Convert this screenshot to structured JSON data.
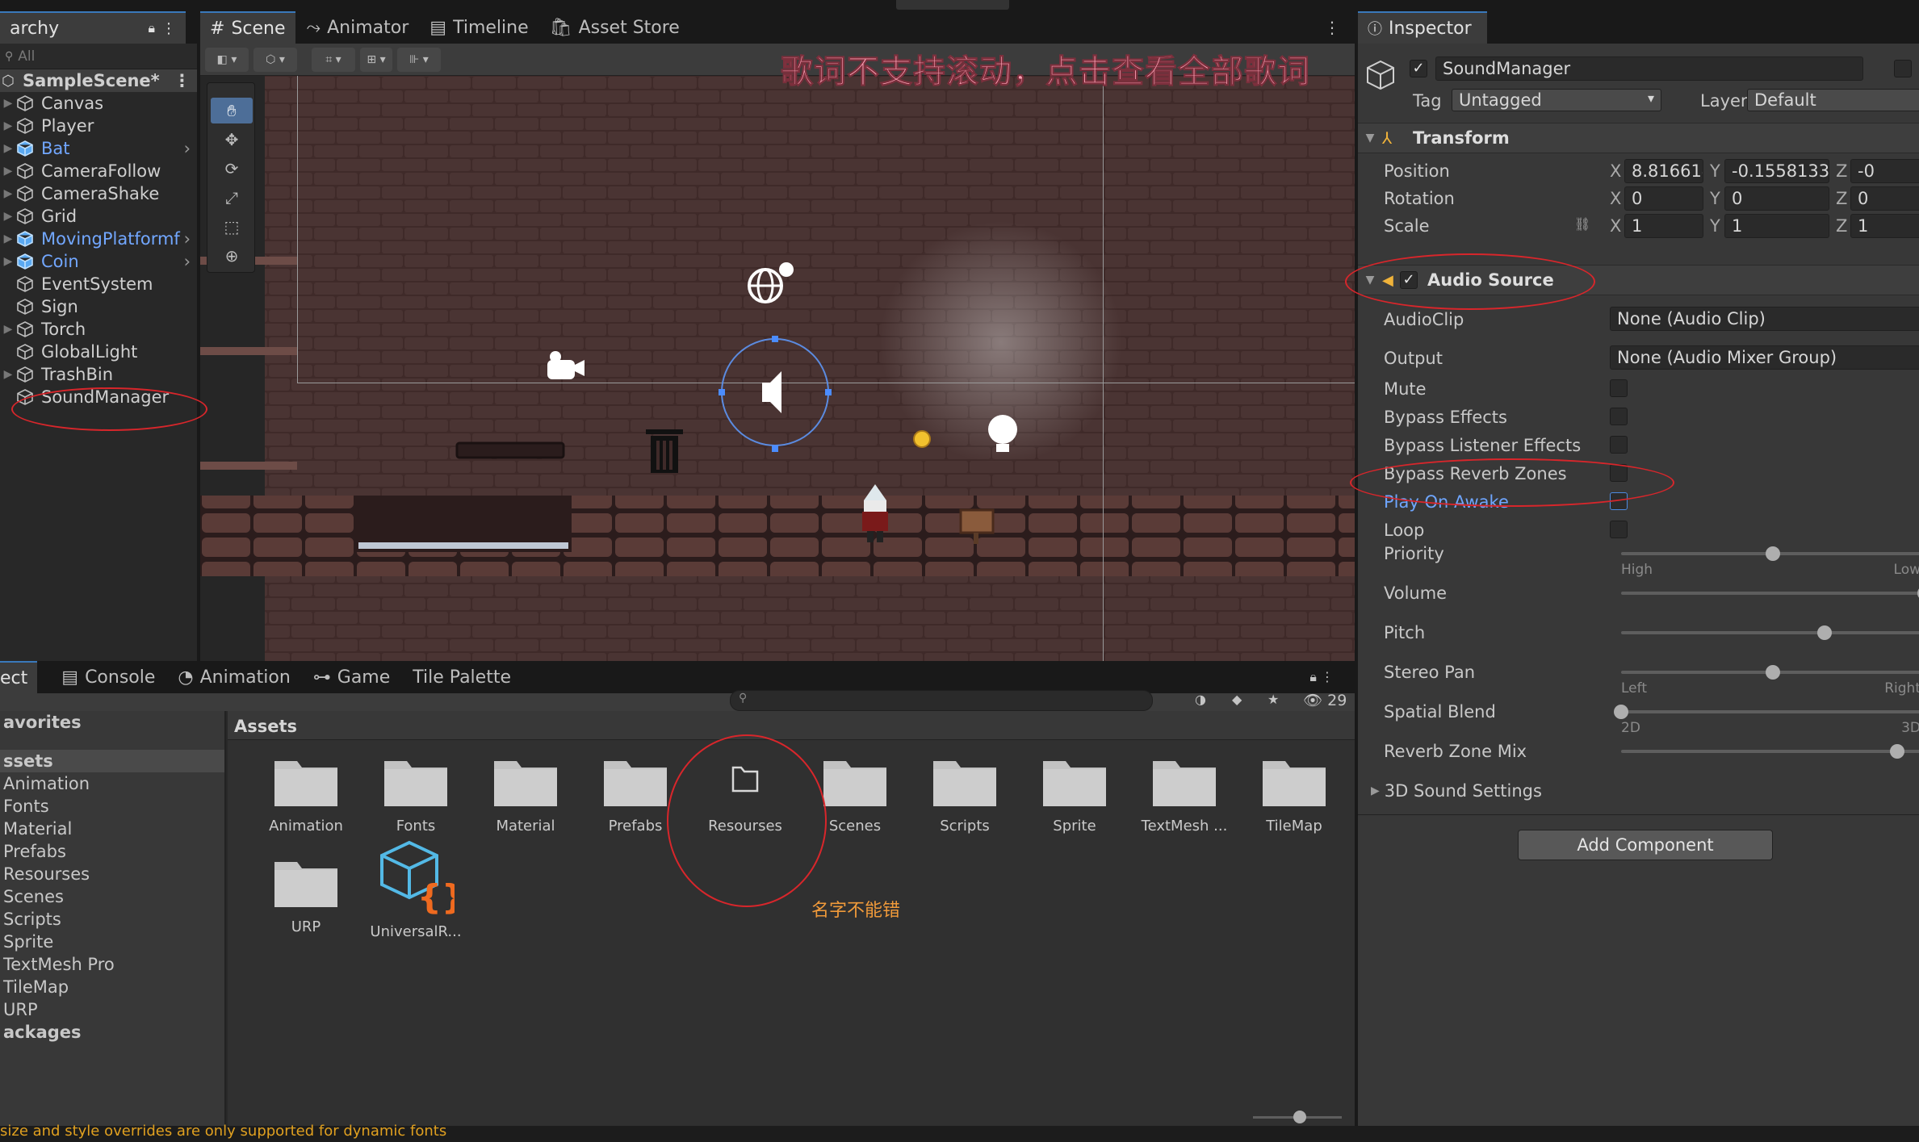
{
  "hierarchy": {
    "tab_label": "archy",
    "search_placeholder": "All",
    "scene_name": "SampleScene*",
    "items": [
      {
        "label": "Canvas",
        "prefab": false,
        "fold": true
      },
      {
        "label": "Player",
        "prefab": false,
        "fold": true
      },
      {
        "label": "Bat",
        "prefab": true,
        "fold": true
      },
      {
        "label": "CameraFollow",
        "prefab": false,
        "fold": true
      },
      {
        "label": "CameraShake",
        "prefab": false,
        "fold": true
      },
      {
        "label": "Grid",
        "prefab": false,
        "fold": true
      },
      {
        "label": "MovingPlatformf",
        "prefab": true,
        "fold": true
      },
      {
        "label": "Coin",
        "prefab": true,
        "fold": true
      },
      {
        "label": "EventSystem",
        "prefab": false,
        "fold": false
      },
      {
        "label": "Sign",
        "prefab": false,
        "fold": false
      },
      {
        "label": "Torch",
        "prefab": false,
        "fold": true
      },
      {
        "label": "GlobalLight",
        "prefab": false,
        "fold": false
      },
      {
        "label": "TrashBin",
        "prefab": false,
        "fold": true
      },
      {
        "label": "SoundManager",
        "prefab": false,
        "fold": false
      }
    ]
  },
  "scene_tabs": [
    "Scene",
    "Animator",
    "Timeline",
    "Asset Store"
  ],
  "lyric_banner": "歌词不支持滚动，点击查看全部歌词",
  "inspector": {
    "tab_label": "Inspector",
    "object_name": "SoundManager",
    "tag_label": "Tag",
    "tag_value": "Untagged",
    "layer_label": "Layer",
    "layer_value": "Default",
    "transform": {
      "title": "Transform",
      "rows": [
        {
          "label": "Position",
          "x": "8.816614",
          "y": "-0.1558133",
          "z": "-0"
        },
        {
          "label": "Rotation",
          "x": "0",
          "y": "0",
          "z": "0"
        },
        {
          "label": "Scale",
          "x": "1",
          "y": "1",
          "z": "1"
        }
      ],
      "axis": {
        "x": "X",
        "y": "Y",
        "z": "Z"
      }
    },
    "audio_source": {
      "title": "Audio Source",
      "audio_clip_label": "AudioClip",
      "audio_clip_value": "None (Audio Clip)",
      "output_label": "Output",
      "output_value": "None (Audio Mixer Group)",
      "checkboxes": [
        {
          "label": "Mute",
          "checked": false,
          "highlight": false
        },
        {
          "label": "Bypass Effects",
          "checked": false,
          "highlight": false
        },
        {
          "label": "Bypass Listener Effects",
          "checked": false,
          "highlight": false
        },
        {
          "label": "Bypass Reverb Zones",
          "checked": false,
          "highlight": false
        },
        {
          "label": "Play On Awake",
          "checked": false,
          "highlight": true
        },
        {
          "label": "Loop",
          "checked": false,
          "highlight": false
        }
      ],
      "sliders": [
        {
          "label": "Priority",
          "value": 0.5,
          "min_label": "High",
          "max_label": "Low"
        },
        {
          "label": "Volume",
          "value": 1.0,
          "min_label": "",
          "max_label": ""
        },
        {
          "label": "Pitch",
          "value": 0.67,
          "min_label": "",
          "max_label": ""
        },
        {
          "label": "Stereo Pan",
          "value": 0.5,
          "min_label": "Left",
          "max_label": "Right"
        },
        {
          "label": "Spatial Blend",
          "value": 0.0,
          "min_label": "2D",
          "max_label": "3D"
        },
        {
          "label": "Reverb Zone Mix",
          "value": 0.91,
          "min_label": "",
          "max_label": ""
        }
      ],
      "sound_settings": "3D Sound Settings"
    },
    "add_component": "Add Component"
  },
  "bottom_tabs": [
    "ect",
    "Console",
    "Animation",
    "Game",
    "Tile Palette"
  ],
  "project": {
    "favorites": "avorites",
    "assets_root": "ssets",
    "tree": [
      "Animation",
      "Fonts",
      "Material",
      "Prefabs",
      "Resourses",
      "Scenes",
      "Scripts",
      "Sprite",
      "TextMesh Pro",
      "TileMap",
      "URP"
    ],
    "packages": "ackages",
    "breadcrumb": "Assets",
    "count": "29",
    "assets": [
      {
        "name": "Animation",
        "kind": "folder"
      },
      {
        "name": "Fonts",
        "kind": "folder"
      },
      {
        "name": "Material",
        "kind": "folder"
      },
      {
        "name": "Prefabs",
        "kind": "folder"
      },
      {
        "name": "Resourses",
        "kind": "folder-open"
      },
      {
        "name": "Scenes",
        "kind": "folder"
      },
      {
        "name": "Scripts",
        "kind": "folder"
      },
      {
        "name": "Sprite",
        "kind": "folder"
      },
      {
        "name": "TextMesh ...",
        "kind": "folder"
      },
      {
        "name": "TileMap",
        "kind": "folder"
      },
      {
        "name": "URP",
        "kind": "folder"
      },
      {
        "name": "UniversalR...",
        "kind": "script"
      }
    ]
  },
  "annotation_note": "名字不能错",
  "status_message": "size and style overrides are only supported for dynamic fonts",
  "colors": {
    "accent": "#3a79bb",
    "prefab": "#72a7ff",
    "annotation": "#d8262b",
    "note": "#f09a3a"
  }
}
